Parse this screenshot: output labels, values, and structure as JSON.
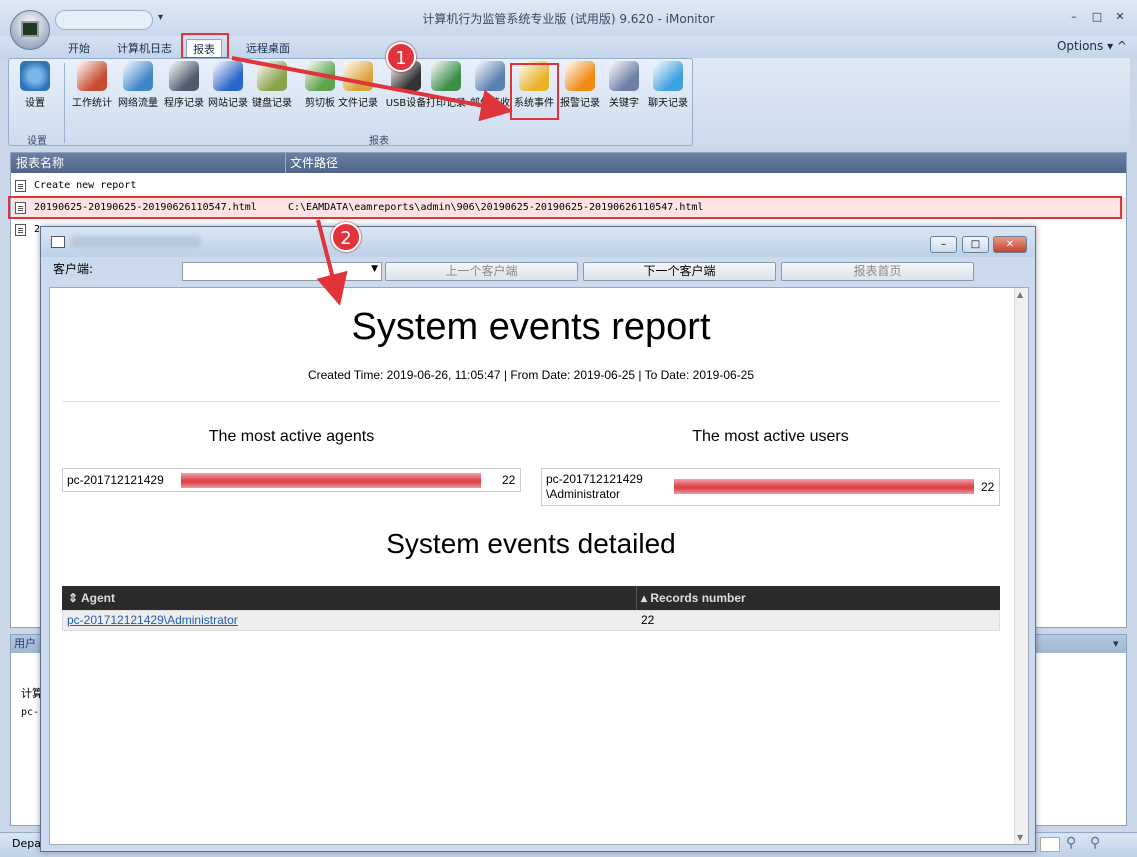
{
  "app": {
    "title": "计算机行为监管系统专业版 (试用版) 9.620 - iMonitor",
    "options_label": "Options",
    "window_controls": {
      "minimize": "–",
      "restore": "□",
      "close": "✕"
    }
  },
  "ribbon_tabs": [
    {
      "label": "开始"
    },
    {
      "label": "计算机日志"
    },
    {
      "label": "报表",
      "active": true
    },
    {
      "label": "远程桌面"
    }
  ],
  "ribbon": {
    "settings_group": {
      "button_label": "设置",
      "group_label": "设置",
      "icon": "gear-icon"
    },
    "reports_group": {
      "group_label": "报表",
      "buttons": [
        {
          "label": "工作统计",
          "icon": "work-stats-icon",
          "color": "#c84a2f"
        },
        {
          "label": "网络流量",
          "icon": "network-traffic-icon",
          "color": "#3f86c8"
        },
        {
          "label": "程序记录",
          "icon": "program-log-icon",
          "color": "#4d5b6d"
        },
        {
          "label": "网站记录",
          "icon": "globe-icon",
          "color": "#2a66c9"
        },
        {
          "label": "键盘记录",
          "icon": "keyboard-icon",
          "color": "#8aa24b"
        },
        {
          "label": "剪切板",
          "icon": "clipboard-icon",
          "color": "#5da34c"
        },
        {
          "label": "文件记录",
          "icon": "file-log-icon",
          "color": "#d9a43a"
        },
        {
          "label": "USB设备",
          "icon": "usb-icon",
          "color": "#333333"
        },
        {
          "label": "打印记录",
          "icon": "printer-icon",
          "color": "#3e8e4a"
        },
        {
          "label": "邮件接收",
          "icon": "mail-icon",
          "color": "#5a7fb0"
        },
        {
          "label": "系统事件",
          "icon": "windows-logo-icon",
          "color": "#e8b22a",
          "highlighted": true
        },
        {
          "label": "报警记录",
          "icon": "warning-icon",
          "color": "#f08a14"
        },
        {
          "label": "关键字",
          "icon": "keyword-icon",
          "color": "#6c7fa6"
        },
        {
          "label": "聊天记录",
          "icon": "chat-icon",
          "color": "#3fa0de"
        }
      ]
    }
  },
  "report_list": {
    "columns": [
      "报表名称",
      "文件路径"
    ],
    "rows": [
      {
        "name": "Create new report",
        "path": ""
      },
      {
        "name": "20190625-20190625-20190626110547.html",
        "path": "C:\\EAMDATA\\eamreports\\admin\\906\\20190625-20190625-20190626110547.html",
        "selected": true
      },
      {
        "name": "2",
        "path": ""
      }
    ]
  },
  "bottom_panel": {
    "header": "用户",
    "line1": "计算",
    "line2": "pc-"
  },
  "statusbar": {
    "left": "Depa"
  },
  "markers": {
    "one": "1",
    "two": "2"
  },
  "dialog": {
    "client_label": "客户端:",
    "buttons": {
      "prev": "上一个客户端",
      "next": "下一个客户端",
      "home": "报表首页"
    },
    "report": {
      "title": "System events report",
      "subtitle": "Created Time: 2019-06-26, 11:05:47 | From Date: 2019-06-25 | To Date: 2019-06-25",
      "agents_title": "The most active agents",
      "users_title": "The most active users",
      "top_agent": {
        "name": "pc-201712121429",
        "count": "22",
        "fraction": 1.0
      },
      "top_user": {
        "name_line1": "pc-201712121429",
        "name_line2": "\\Administrator",
        "count": "22",
        "fraction": 1.0
      },
      "detail_title": "System events detailed",
      "table": {
        "col_agent": "Agent",
        "col_records": "Records number",
        "sort_agent": "⇕",
        "sort_records": "▴",
        "row": {
          "agent": "pc-201712121429\\Administrator",
          "records": "22"
        }
      }
    }
  },
  "colors": {
    "highlight_red": "#e0333a",
    "selected_row": "#fde3e4",
    "bar_red": "#d83f47"
  }
}
